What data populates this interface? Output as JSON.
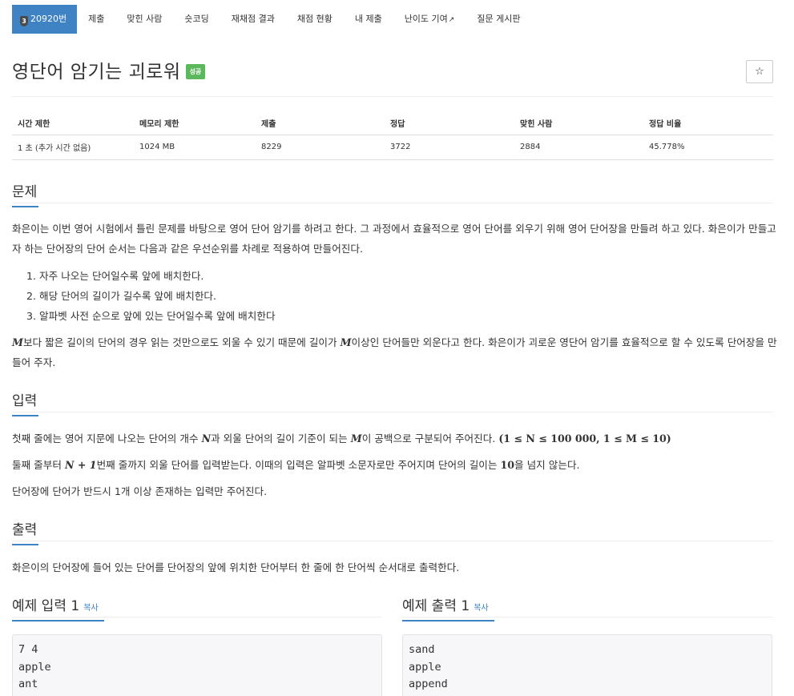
{
  "nav": {
    "problem_number": "20920번",
    "level_badge": "3",
    "items": [
      "제출",
      "맞힌 사람",
      "숏코딩",
      "재채점 결과",
      "채점 현황",
      "내 제출",
      "난이도 기여",
      "질문 게시판"
    ]
  },
  "title": "영단어 암기는 괴로워",
  "status_badge": "성공",
  "star": "☆",
  "info": {
    "headers": [
      "시간 제한",
      "메모리 제한",
      "제출",
      "정답",
      "맞힌 사람",
      "정답 비율"
    ],
    "values": [
      "1 초 (추가 시간 없음)",
      "1024 MB",
      "8229",
      "3722",
      "2884",
      "45.778%"
    ]
  },
  "problem": {
    "heading": "문제",
    "para1": "화은이는 이번 영어 시험에서 틀린 문제를 바탕으로 영어 단어 암기를 하려고 한다. 그 과정에서 효율적으로 영어 단어를 외우기 위해 영어 단어장을 만들려 하고 있다. 화은이가 만들고자 하는 단어장의 단어 순서는 다음과 같은 우선순위를 차례로 적용하여 만들어진다.",
    "rules": [
      "1. 자주 나오는 단어일수록 앞에 배치한다.",
      "2. 해당 단어의 길이가 길수록 앞에 배치한다.",
      "3. 알파벳 사전 순으로 앞에 있는 단어일수록 앞에 배치한다"
    ],
    "para2_m1": "M",
    "para2_a": "보다 짧은 길이의 단어의 경우 읽는 것만으로도 외울 수 있기 때문에 길이가 ",
    "para2_m2": "M",
    "para2_b": "이상인 단어들만 외운다고 한다. 화은이가 괴로운 영단어 암기를 효율적으로 할 수 있도록 단어장을 만들어 주자."
  },
  "input": {
    "heading": "입력",
    "l1_a": "첫째 줄에는 영어 지문에 나오는 단어의 개수 ",
    "l1_n": "N",
    "l1_b": "과 외울 단어의 길이 기준이 되는 ",
    "l1_m": "M",
    "l1_c": "이 공백으로 구분되어 주어진다. ",
    "l1_math": "(1 ≤ N ≤ 100 000, 1 ≤ M ≤ 10)",
    "l2_a": "둘째 줄부터 ",
    "l2_math": "N + 1",
    "l2_b": "번째 줄까지 외울 단어를 입력받는다. 이때의 입력은 알파벳 소문자로만 주어지며 단어의 길이는 ",
    "l2_num": "10",
    "l2_c": "을 넘지 않는다.",
    "l3": "단어장에 단어가 반드시 1개 이상 존재하는 입력만 주어진다."
  },
  "output": {
    "heading": "출력",
    "text": "화은이의 단어장에 들어 있는 단어를 단어장의 앞에 위치한 단어부터 한 줄에 한 단어씩 순서대로 출력한다."
  },
  "samples": {
    "input_heading": "예제 입력 1",
    "output_heading": "예제 출력 1",
    "copy_label": "복사",
    "input_lines": [
      "7 4",
      "apple",
      "ant"
    ],
    "output_lines": [
      "sand",
      "apple",
      "append"
    ]
  }
}
